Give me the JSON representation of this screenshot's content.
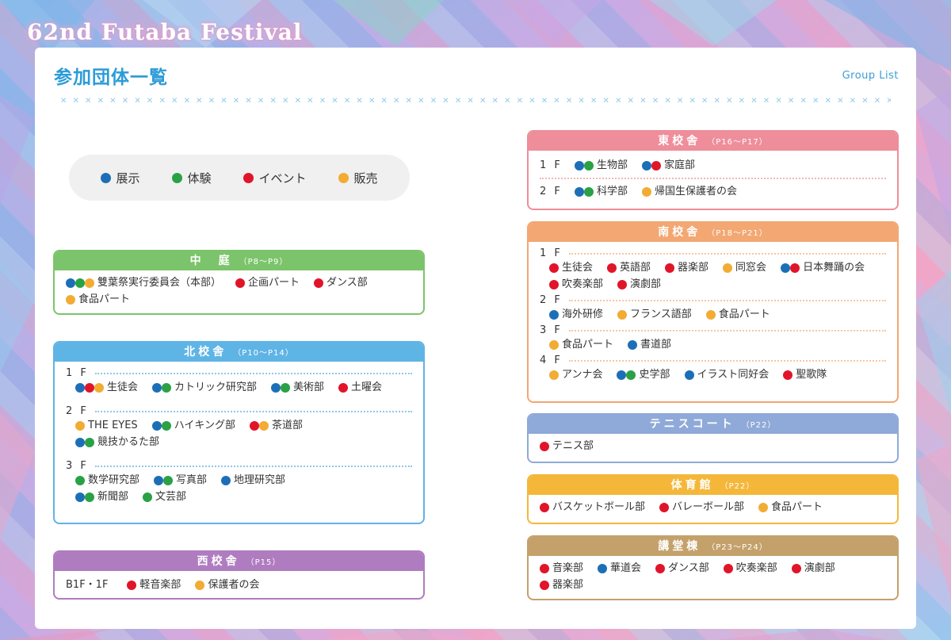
{
  "header": {
    "festival_title": "62nd Futaba Festival"
  },
  "page": {
    "title": "参加団体一覧",
    "subtitle": "Group List"
  },
  "decor": {
    "line": "✕ ✕ ✕ ✕ ✕ ✕ ✕ ✕ ✕ ✕ ✕ ✕ ✕ ✕ ✕ ✕ ✕ ✕ ✕ ✕ ✕ ✕ ✕ ✕ ✕ ✕ ✕ ✕ ✕ ✕ ✕ ✕ ✕ ✕ ✕ ✕ ✕ ✕ ✕ ✕ ✕ ✕ ✕ ✕ ✕ ✕ ✕ ✕ ✕ ✕ ✕ ✕ ✕ ✕ ✕ ✕ ✕ ✕ ✕ ✕ ✕ ✕ ✕ ✕ ✕ ✕ ✕ ✕ ✕ ✕ ✕ ✕ ✕ ✕ ✕ ✕ ✕ ✕ ✕ ✕ ✕ ✕ ✕ ✕ ✕ ✕ ✕ ✕ ✕ ✕ ✕ ✕ ✕ ✕ ✕"
  },
  "colors": {
    "blue": "#1c6fb7",
    "green": "#2aa145",
    "red": "#e0152a",
    "orange": "#f2ac33"
  },
  "legend": [
    {
      "color": "blue",
      "label": "展示"
    },
    {
      "color": "green",
      "label": "体験"
    },
    {
      "color": "red",
      "label": "イベント"
    },
    {
      "color": "orange",
      "label": "販売"
    }
  ],
  "sections": {
    "nakaniwa": {
      "title": "中　庭",
      "pages": "（P8～P9）",
      "color": "#7cc46b",
      "rows": [
        [
          {
            "dots": [
              "blue",
              "green",
              "orange"
            ],
            "name": "雙葉祭実行委員会（本部）"
          },
          {
            "dots": [
              "red"
            ],
            "name": "企画パート"
          },
          {
            "dots": [
              "red"
            ],
            "name": "ダンス部"
          }
        ],
        [
          {
            "dots": [
              "orange"
            ],
            "name": "食品パート"
          }
        ]
      ]
    },
    "kita": {
      "title": "北校舎",
      "pages": "（P10～P14）",
      "color": "#5fb4e6",
      "floors": [
        {
          "label": "1 F",
          "rows": [
            [
              {
                "dots": [
                  "blue",
                  "red",
                  "orange"
                ],
                "name": "生徒会"
              },
              {
                "dots": [
                  "blue",
                  "green"
                ],
                "name": "カトリック研究部"
              },
              {
                "dots": [
                  "blue",
                  "green"
                ],
                "name": "美術部"
              },
              {
                "dots": [
                  "red"
                ],
                "name": "土曜会"
              }
            ]
          ]
        },
        {
          "label": "2 F",
          "rows": [
            [
              {
                "dots": [
                  "orange"
                ],
                "name": "THE EYES"
              },
              {
                "dots": [
                  "blue",
                  "green"
                ],
                "name": "ハイキング部"
              },
              {
                "dots": [
                  "red",
                  "orange"
                ],
                "name": "茶道部"
              }
            ],
            [
              {
                "dots": [
                  "blue",
                  "green"
                ],
                "name": "競技かるた部"
              }
            ]
          ]
        },
        {
          "label": "3 F",
          "rows": [
            [
              {
                "dots": [
                  "green"
                ],
                "name": "数学研究部"
              },
              {
                "dots": [
                  "blue",
                  "green"
                ],
                "name": "写真部"
              },
              {
                "dots": [
                  "blue"
                ],
                "name": "地理研究部"
              }
            ],
            [
              {
                "dots": [
                  "blue",
                  "green"
                ],
                "name": "新聞部"
              },
              {
                "dots": [
                  "green"
                ],
                "name": "文芸部"
              }
            ]
          ]
        }
      ]
    },
    "nishi": {
      "title": "西校舎",
      "pages": "（P15）",
      "color": "#b07cc0",
      "floor_label": "B1F・1F",
      "rows": [
        [
          {
            "dots": [
              "red"
            ],
            "name": "軽音楽部"
          },
          {
            "dots": [
              "orange"
            ],
            "name": "保護者の会"
          }
        ]
      ]
    },
    "higashi": {
      "title": "東校舎",
      "pages": "（P16～P17）",
      "color": "#ee8e9a",
      "floors": [
        {
          "label": "1 F",
          "entries": [
            {
              "dots": [
                "blue",
                "green"
              ],
              "name": "生物部"
            },
            {
              "dots": [
                "blue",
                "red"
              ],
              "name": "家庭部"
            }
          ]
        },
        {
          "label": "2 F",
          "entries": [
            {
              "dots": [
                "blue",
                "green"
              ],
              "name": "科学部"
            },
            {
              "dots": [
                "orange"
              ],
              "name": "帰国生保護者の会"
            }
          ]
        }
      ]
    },
    "minami": {
      "title": "南校舎",
      "pages": "（P18～P21）",
      "color": "#f3a772",
      "floors": [
        {
          "label": "1 F",
          "rows": [
            [
              {
                "dots": [
                  "red"
                ],
                "name": "生徒会"
              },
              {
                "dots": [
                  "red"
                ],
                "name": "英語部"
              },
              {
                "dots": [
                  "red"
                ],
                "name": "器楽部"
              },
              {
                "dots": [
                  "orange"
                ],
                "name": "同窓会"
              },
              {
                "dots": [
                  "blue",
                  "red"
                ],
                "name": "日本舞踊の会"
              }
            ],
            [
              {
                "dots": [
                  "red"
                ],
                "name": "吹奏楽部"
              },
              {
                "dots": [
                  "red"
                ],
                "name": "演劇部"
              }
            ]
          ]
        },
        {
          "label": "2 F",
          "rows": [
            [
              {
                "dots": [
                  "blue"
                ],
                "name": "海外研修"
              },
              {
                "dots": [
                  "orange"
                ],
                "name": "フランス語部"
              },
              {
                "dots": [
                  "orange"
                ],
                "name": "食品パート"
              }
            ]
          ]
        },
        {
          "label": "3 F",
          "rows": [
            [
              {
                "dots": [
                  "orange"
                ],
                "name": "食品パート"
              },
              {
                "dots": [
                  "blue"
                ],
                "name": "書道部"
              }
            ]
          ]
        },
        {
          "label": "4 F",
          "rows": [
            [
              {
                "dots": [
                  "orange"
                ],
                "name": "アンナ会"
              },
              {
                "dots": [
                  "blue",
                  "green"
                ],
                "name": "史学部"
              },
              {
                "dots": [
                  "blue"
                ],
                "name": "イラスト同好会"
              },
              {
                "dots": [
                  "red"
                ],
                "name": "聖歌隊"
              }
            ]
          ]
        }
      ]
    },
    "tennis": {
      "title": "テニスコート",
      "pages": "（P22）",
      "color": "#8fa9d8",
      "rows": [
        [
          {
            "dots": [
              "red"
            ],
            "name": "テニス部"
          }
        ]
      ]
    },
    "taiikukan": {
      "title": "体育館",
      "pages": "（P22）",
      "color": "#f4b73a",
      "rows": [
        [
          {
            "dots": [
              "red"
            ],
            "name": "バスケットボール部"
          },
          {
            "dots": [
              "red"
            ],
            "name": "バレーボール部"
          },
          {
            "dots": [
              "orange"
            ],
            "name": "食品パート"
          }
        ]
      ]
    },
    "koudou": {
      "title": "講堂棟",
      "pages": "（P23～P24）",
      "color": "#c4a16b",
      "rows": [
        [
          {
            "dots": [
              "red"
            ],
            "name": "音楽部"
          },
          {
            "dots": [
              "blue"
            ],
            "name": "華道会"
          },
          {
            "dots": [
              "red"
            ],
            "name": "ダンス部"
          },
          {
            "dots": [
              "red"
            ],
            "name": "吹奏楽部"
          },
          {
            "dots": [
              "red"
            ],
            "name": "演劇部"
          }
        ],
        [
          {
            "dots": [
              "red"
            ],
            "name": "器楽部"
          }
        ]
      ]
    }
  }
}
